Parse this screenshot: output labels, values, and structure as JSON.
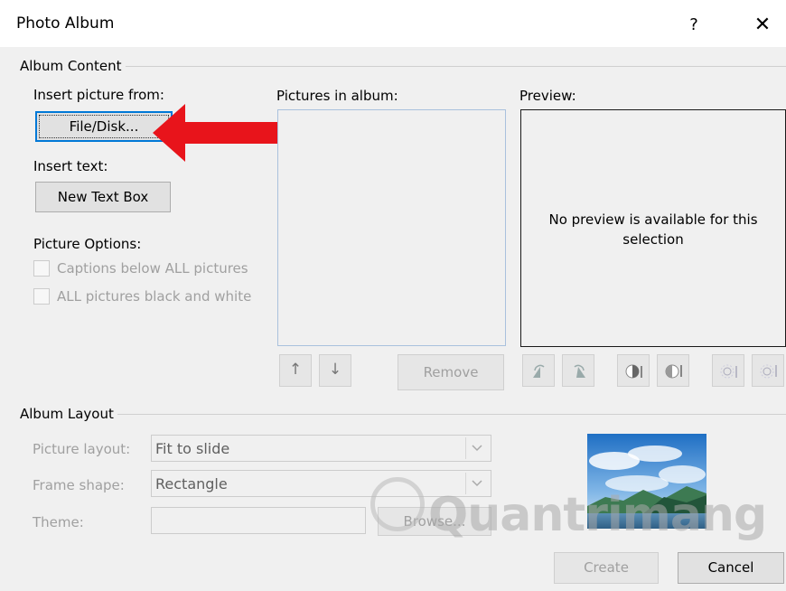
{
  "window": {
    "title": "Photo Album",
    "help_glyph": "?",
    "close_glyph": "✕"
  },
  "album_content": {
    "group_label": "Album Content",
    "insert_picture_label": "Insert picture from:",
    "file_disk_button": "File/Disk...",
    "insert_text_label": "Insert text:",
    "new_text_box_button": "New Text Box",
    "picture_options_label": "Picture Options:",
    "options": [
      {
        "label": "Captions below ALL pictures",
        "checked": false,
        "enabled": false
      },
      {
        "label": "ALL pictures black and white",
        "checked": false,
        "enabled": false
      }
    ],
    "pictures_in_album_label": "Pictures in album:",
    "move_up_glyph": "↑",
    "move_down_glyph": "↓",
    "remove_button": "Remove",
    "preview_label": "Preview:",
    "preview_message": "No preview is available for this selection"
  },
  "album_layout": {
    "group_label": "Album Layout",
    "picture_layout_label": "Picture layout:",
    "picture_layout_value": "Fit to slide",
    "frame_shape_label": "Frame shape:",
    "frame_shape_value": "Rectangle",
    "theme_label": "Theme:",
    "theme_value": "",
    "browse_button": "Browse..."
  },
  "footer": {
    "create_button": "Create",
    "cancel_button": "Cancel"
  },
  "annotation": {
    "arrow_color": "#e8141b"
  },
  "watermark": {
    "text": "Quantrimang"
  },
  "colors": {
    "focus_border": "#0078d7",
    "dialog_bg": "#f0f0f0",
    "disabled_text": "#a0a0a0"
  }
}
